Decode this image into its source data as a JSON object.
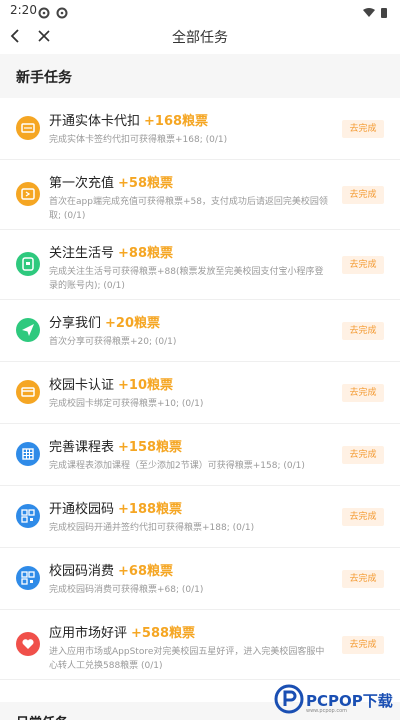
{
  "status_bar": {
    "time": "2:20"
  },
  "nav": {
    "title": "全部任务"
  },
  "section_new": {
    "title": "新手任务"
  },
  "tasks": [
    {
      "name": "开通实体卡代扣",
      "points": "+168粮票",
      "desc": "完成实体卡签约代扣可获得粮票+168;  (0/1)",
      "button": "去完成",
      "icon": "card-icon",
      "color": "#f5a623"
    },
    {
      "name": "第一次充值",
      "points": "+58粮票",
      "desc": "首次在app端完成充值可获得粮票+58，支付成功后请返回完美校园领取;  (0/1)",
      "button": "去完成",
      "icon": "recharge-icon",
      "color": "#f5a623"
    },
    {
      "name": "关注生活号",
      "points": "+88粮票",
      "desc": "完成关注生活号可获得粮票+88(粮票发放至完美校园支付宝小程序登录的账号内);  (0/1)",
      "button": "去完成",
      "icon": "life-account-icon",
      "color": "#2ec97e"
    },
    {
      "name": "分享我们",
      "points": "+20粮票",
      "desc": "首次分享可获得粮票+20;  (0/1)",
      "button": "去完成",
      "icon": "share-icon",
      "color": "#2ec97e"
    },
    {
      "name": "校园卡认证",
      "points": "+10粮票",
      "desc": "完成校园卡绑定可获得粮票+10;  (0/1)",
      "button": "去完成",
      "icon": "campus-card-icon",
      "color": "#f5a623"
    },
    {
      "name": "完善课程表",
      "points": "+158粮票",
      "desc": "完成课程表添加课程（至少添加2节课）可获得粮票+158;  (0/1)",
      "button": "去完成",
      "icon": "schedule-icon",
      "color": "#2f8be8"
    },
    {
      "name": "开通校园码",
      "points": "+188粮票",
      "desc": "完成校园码开通并签约代扣可获得粮票+188;  (0/1)",
      "button": "去完成",
      "icon": "qr-code-icon",
      "color": "#2f8be8"
    },
    {
      "name": "校园码消费",
      "points": "+68粮票",
      "desc": "完成校园码消费可获得粮票+68;  (0/1)",
      "button": "去完成",
      "icon": "qr-pay-icon",
      "color": "#2f8be8"
    },
    {
      "name": "应用市场好评",
      "points": "+588粮票",
      "desc": "进入应用市场或AppStore对完美校园五星好评，进入完美校园客服中心转人工兑换588粮票  (0/1)",
      "button": "去完成",
      "icon": "heart-icon",
      "color": "#f0504a"
    }
  ],
  "section_daily": {
    "title": "日常任务"
  },
  "watermark": {
    "brand": "PCPOP下载",
    "sub": "www.pcpop.com"
  }
}
